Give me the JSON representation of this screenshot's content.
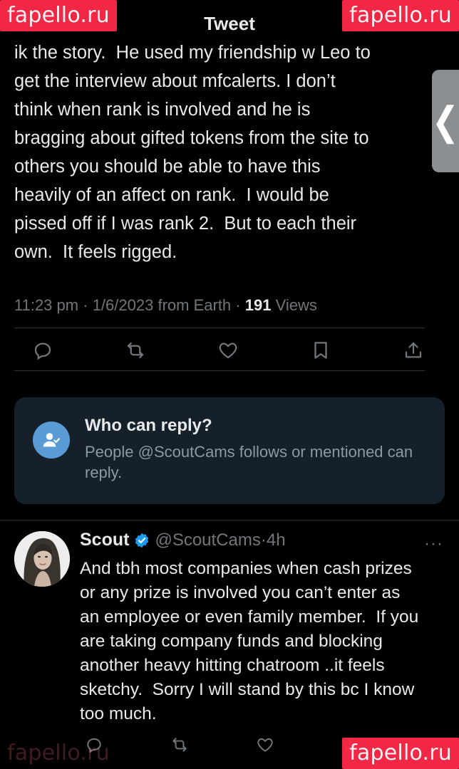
{
  "header": {
    "title": "Tweet"
  },
  "watermarks": {
    "top_left": "fapello.ru",
    "top_right": "fapello.ru",
    "bottom_left": "fapello.ru",
    "bottom_right": "fapello.ru"
  },
  "side_handle": {
    "glyph": "❮"
  },
  "tweet": {
    "text": "ik the story.  He used my friendship w Leo to\nget the interview about mfcalerts. I don’t\nthink when rank is involved and he is\nbragging about gifted tokens from the site to\nothers you should be able to have this\nheavily of an affect on rank.  I would be\npissed off if I was rank 2.  But to each their\nown.  It feels rigged.",
    "time": "11:23 pm",
    "date": "1/6/2023",
    "location": "from Earth",
    "views_count": "191",
    "views_label": "Views",
    "separator": "·"
  },
  "actions": {
    "icons": [
      "comment-icon",
      "retweet-icon",
      "like-icon",
      "bookmark-icon",
      "share-icon"
    ]
  },
  "reply_restriction": {
    "title": "Who can reply?",
    "description": "People @ScoutCams follows or mentioned can reply.",
    "icon": "user-check-icon",
    "icon_color": "#5b9bd5",
    "background": "#15202b"
  },
  "reply": {
    "name": "Scout",
    "handle": "@ScoutCams",
    "separator": "·",
    "time": "4h",
    "more": "···",
    "text": "And tbh most companies when cash prizes\nor any prize is involved you can’t enter as\nan employee or even family member.  If you\nare taking company funds and blocking\nanother heavy hitting chatroom ..it feels\nsketchy.  Sorry I will stand by this bc I know\ntoo much.",
    "verified_color": "#1d9bf0"
  },
  "colors": {
    "background": "#000000",
    "text": "#e7e9ea",
    "muted": "#71767b",
    "watermark": "#ff2a4a"
  }
}
